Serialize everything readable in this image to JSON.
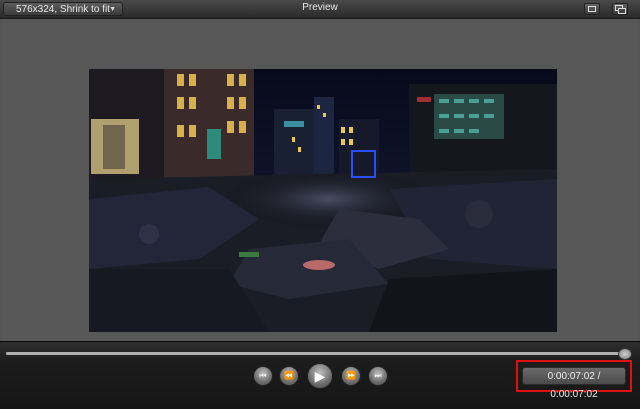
{
  "titlebar": {
    "dropdown_value": "576x324, Shrink to fit",
    "title": "Preview",
    "buttons": [
      {
        "icon": "fit-to-window-icon"
      },
      {
        "icon": "detach-window-icon"
      }
    ]
  },
  "playback": {
    "progress": 1.0,
    "time_display": "0:00:07:02 / 0:00:07:02",
    "buttons": [
      {
        "icon": "skip-to-start-icon",
        "glyph": "⏮"
      },
      {
        "icon": "rewind-icon",
        "glyph": "⏪"
      },
      {
        "icon": "play-icon",
        "glyph": "▶"
      },
      {
        "icon": "fast-forward-icon",
        "glyph": "⏩"
      },
      {
        "icon": "skip-to-end-icon",
        "glyph": "⏭"
      }
    ]
  },
  "colors": {
    "highlight_border": "#e01010",
    "selection_box": "#2a4cff"
  }
}
